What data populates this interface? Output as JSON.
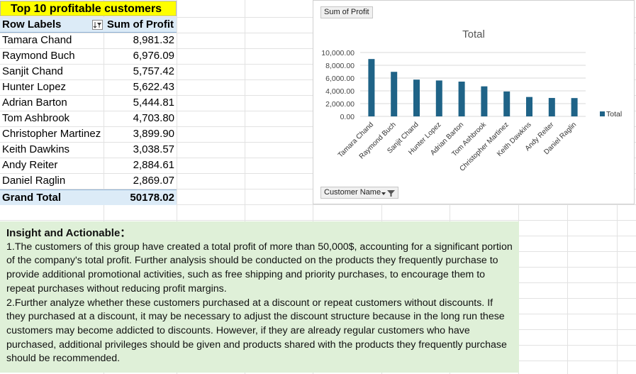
{
  "pivot": {
    "title": "Top 10 profitable customers",
    "header": {
      "row_labels": "Row Labels",
      "value_label": "Sum of Profit"
    },
    "rows": [
      {
        "name": "Tamara Chand",
        "value": "8,981.32"
      },
      {
        "name": "Raymond Buch",
        "value": "6,976.09"
      },
      {
        "name": "Sanjit Chand",
        "value": "5,757.42"
      },
      {
        "name": "Hunter Lopez",
        "value": "5,622.43"
      },
      {
        "name": "Adrian Barton",
        "value": "5,444.81"
      },
      {
        "name": "Tom Ashbrook",
        "value": "4,703.80"
      },
      {
        "name": "Christopher Martinez",
        "value": "3,899.90"
      },
      {
        "name": "Keith Dawkins",
        "value": "3,038.57"
      },
      {
        "name": "Andy Reiter",
        "value": "2,884.61"
      },
      {
        "name": "Daniel Raglin",
        "value": "2,869.07"
      }
    ],
    "grand_total": {
      "label": "Grand Total",
      "value": "50178.02"
    }
  },
  "chart": {
    "field_button": "Sum of Profit",
    "axis_field_button": "Customer Name",
    "bar_color": "#1f6387"
  },
  "chart_data": {
    "type": "bar",
    "title": "Total",
    "categories": [
      "Tamara Chand",
      "Raymond Buch",
      "Sanjit Chand",
      "Hunter Lopez",
      "Adrian Barton",
      "Tom Ashbrook",
      "Christopher Martinez",
      "Keith Dawkins",
      "Andy Reiter",
      "Daniel Raglin"
    ],
    "series": [
      {
        "name": "Total",
        "values": [
          8981.32,
          6976.09,
          5757.42,
          5622.43,
          5444.81,
          4703.8,
          3899.9,
          3038.57,
          2884.61,
          2869.07
        ]
      }
    ],
    "yticks": [
      "0.00",
      "2,000.00",
      "4,000.00",
      "6,000.00",
      "8,000.00",
      "10,000.00"
    ],
    "ylim": [
      0,
      10000
    ],
    "legend": "right",
    "grid": true
  },
  "insight": {
    "heading": "Insight and Actionable：",
    "paragraphs": [
      "1.The customers of this group have created a total profit of more than 50,000$, accounting for a significant portion of the company's total profit. Further analysis should be conducted on the products they frequently purchase to provide additional promotional activities, such as free shipping and priority purchases, to encourage them to repeat purchases without reducing profit margins.",
      "2.Further analyze whether these customers purchased at a discount or repeat customers without discounts. If they purchased at a discount, it may be necessary to adjust the discount structure because in the long run these customers may become addicted to discounts. However, if they are already regular customers who have purchased, additional privileges should be given and products shared with the products they frequently purchase should be recommended."
    ]
  }
}
